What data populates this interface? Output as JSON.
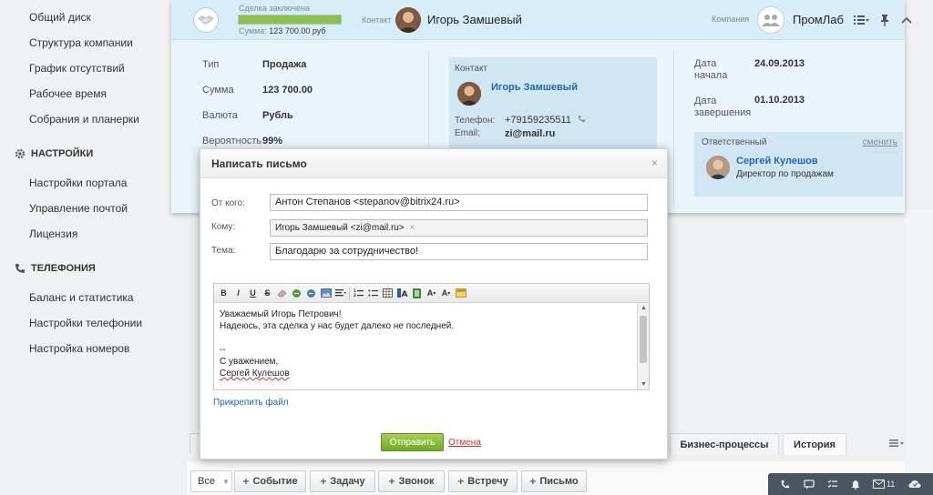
{
  "sidebar": {
    "items_top": [
      {
        "label": "Общий диск"
      },
      {
        "label": "Структура компании"
      },
      {
        "label": "График отсутствий"
      },
      {
        "label": "Рабочее время"
      },
      {
        "label": "Собрания и планерки"
      }
    ],
    "settings_section": {
      "label": "НАСТРОЙКИ",
      "icon": "gear-icon"
    },
    "settings_items": [
      {
        "label": "Настройки портала"
      },
      {
        "label": "Управление почтой"
      },
      {
        "label": "Лицензия"
      }
    ],
    "telephony_section": {
      "label": "ТЕЛЕФОНИЯ",
      "icon": "phone-icon"
    },
    "telephony_items": [
      {
        "label": "Баланс и статистика"
      },
      {
        "label": "Настройки телефонии"
      },
      {
        "label": "Настройка номеров"
      }
    ]
  },
  "deal": {
    "header": {
      "stage_label": "Сделка заключена",
      "progress_fraction": 1.0,
      "sum_label": "Сумма:",
      "sum_value": "123 700.00 руб",
      "contact_label": "Контакт",
      "contact_name": "Игорь Замшевый",
      "company_label": "Компания",
      "company_name": "ПромЛаб"
    },
    "fields": [
      {
        "label": "Тип",
        "value": "Продажа"
      },
      {
        "label": "Сумма",
        "value": "123 700.00"
      },
      {
        "label": "Валюта",
        "value": "Рубль"
      },
      {
        "label": "Вероятность",
        "value": "99%"
      }
    ],
    "contact_box": {
      "title": "Контакт",
      "name": "Игорь Замшевый",
      "phone_label": "Телефон:",
      "phone_value": "+79159235511",
      "email_label": "Email:",
      "email_value": "zi@mail.ru"
    },
    "dates": [
      {
        "label_line1": "Дата",
        "label_line2": "начала",
        "value": "24.09.2013"
      },
      {
        "label_line1": "Дата",
        "label_line2": "завершения",
        "value": "01.10.2013"
      }
    ],
    "responsible": {
      "title": "Ответственный",
      "change_label": "сменить",
      "name": "Сергей Кулешов",
      "position": "Директор по продажам"
    }
  },
  "tabs": [
    {
      "label": "Бизнес-процессы"
    },
    {
      "label": "История"
    }
  ],
  "toolbar": {
    "filter_value": "Все",
    "buttons": [
      {
        "label": "Событие"
      },
      {
        "label": "Задачу"
      },
      {
        "label": "Звонок"
      },
      {
        "label": "Встречу"
      },
      {
        "label": "Письмо"
      }
    ]
  },
  "chatbar": {
    "mail_count": "11"
  },
  "modal": {
    "title": "Написать письмо",
    "close_glyph": "×",
    "from_label": "От кого:",
    "from_value": "Антон Степанов <stepanov@bitrix24.ru>",
    "to_label": "Кому:",
    "to_value": "Игорь Замшевый <zi@mail.ru>",
    "to_remove_glyph": "×",
    "subject_label": "Тема:",
    "subject_value": "Благодарю за сотрудничество!",
    "body_lines": [
      "Уважаемый Игорь Петрович!",
      "Надеюсь, эта сделка у нас будет далеко не последней.",
      "",
      "--",
      "С уважением,",
      "Сергей Кулешов"
    ],
    "attach_label": "Прикрепить файл",
    "send_label": "Отправить",
    "cancel_label": "Отмена"
  },
  "colors": {
    "link": "#2067b0",
    "header_bg": "#d7edf7",
    "send_green": "#6fa82a",
    "cancel_red": "#d0342c"
  }
}
